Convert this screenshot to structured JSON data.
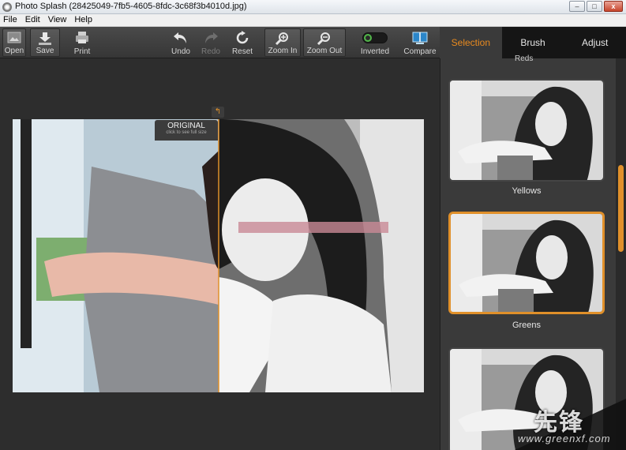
{
  "window": {
    "title": "Photo Splash (28425049-7fb5-4605-8fdc-3c68f3b4010d.jpg)"
  },
  "menu": [
    "File",
    "Edit",
    "View",
    "Help"
  ],
  "toolbar": {
    "open": "Open",
    "save": "Save",
    "print": "Print",
    "undo": "Undo",
    "redo": "Redo",
    "reset": "Reset",
    "zoom_in": "Zoom In",
    "zoom_out": "Zoom Out",
    "inverted": "Inverted",
    "compare": "Compare"
  },
  "tabs": [
    "Selection",
    "Brush",
    "Adjust"
  ],
  "presets": {
    "partial_label": "Reds",
    "items": [
      {
        "label": "Yellows"
      },
      {
        "label": "Greens"
      },
      {
        "label": ""
      }
    ]
  },
  "canvas": {
    "original_title": "ORIGINAL",
    "original_hint": "click to see full size"
  },
  "watermark": {
    "text": "先锋",
    "url": "www.greenxf.com"
  },
  "colors": {
    "accent": "#e0902a",
    "toggle_on": "#52b84a"
  }
}
